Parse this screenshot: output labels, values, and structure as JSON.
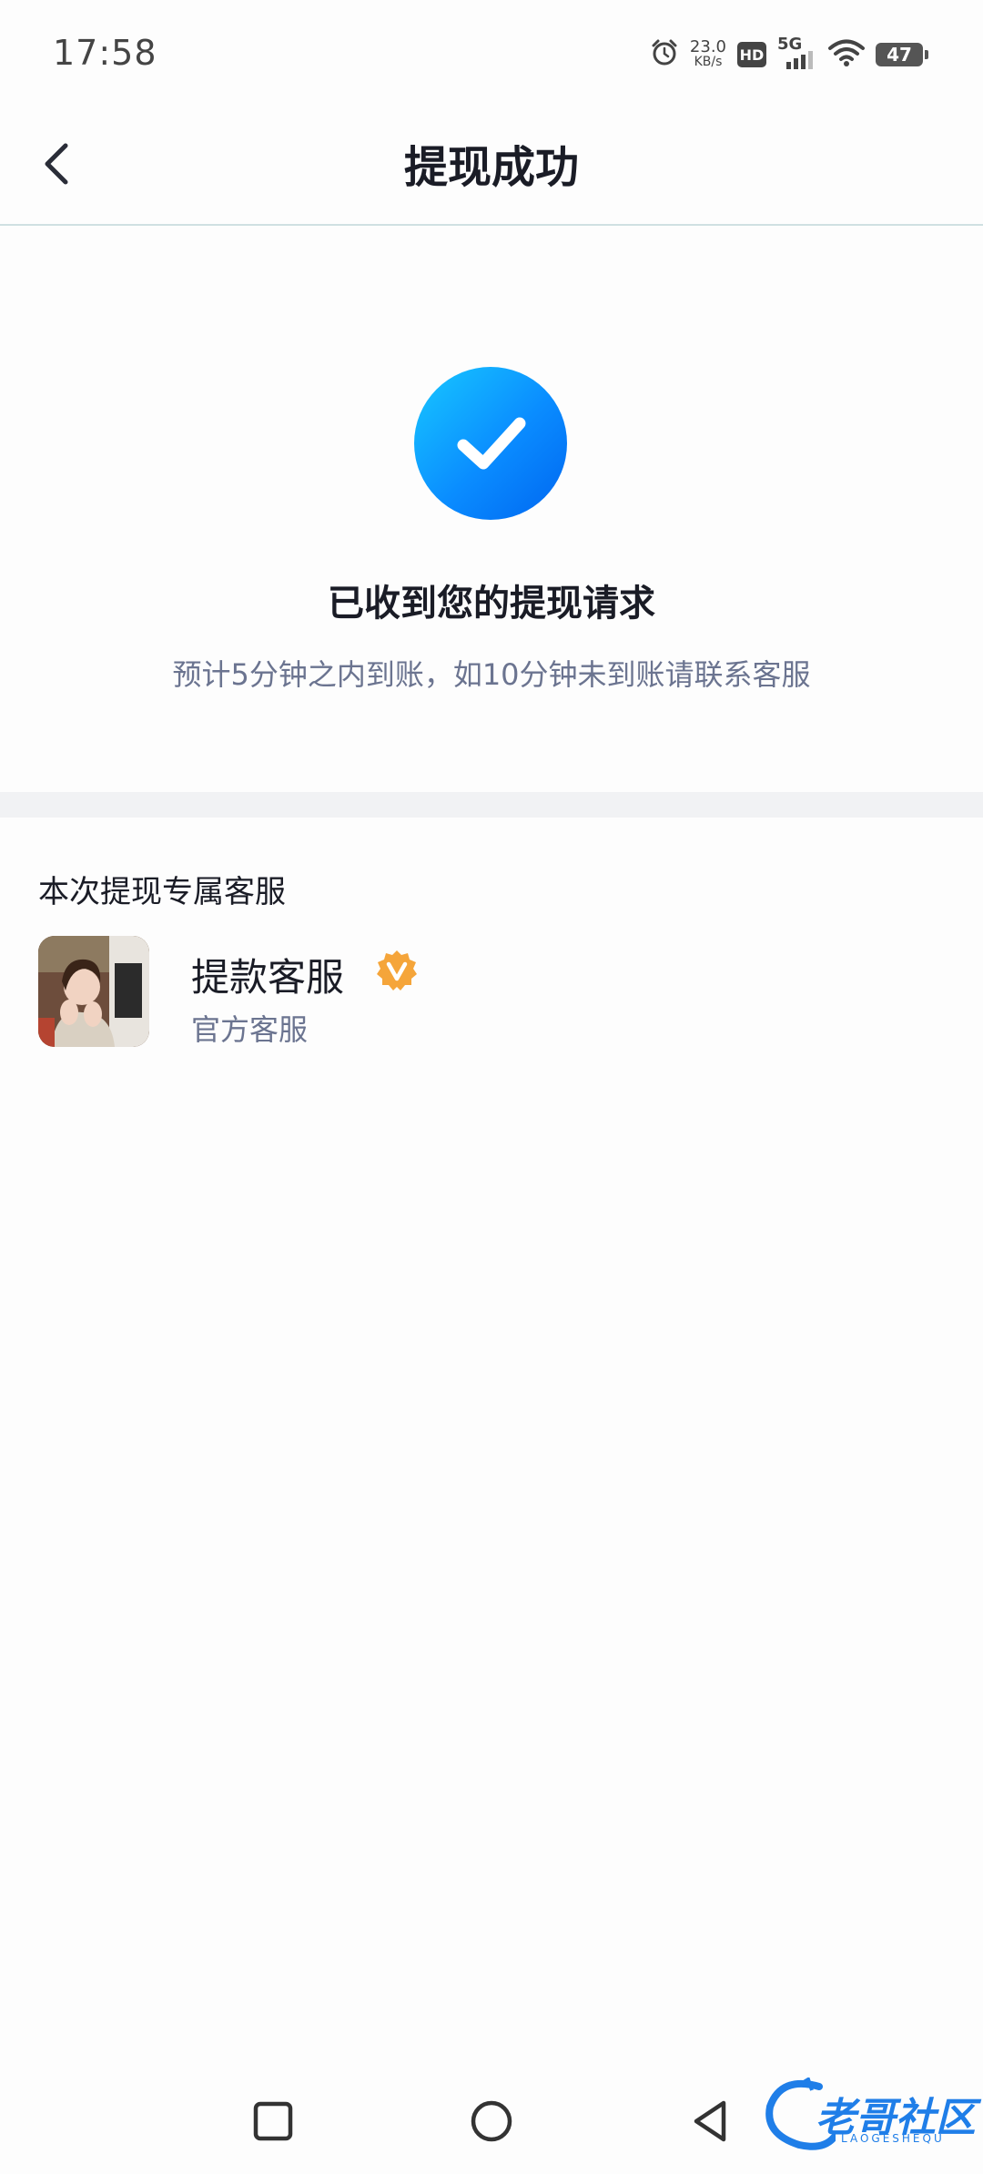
{
  "status_bar": {
    "time": "17:58",
    "net_speed_value": "23.0",
    "net_speed_unit": "KB/s",
    "hd_label": "HD",
    "network_label": "5G",
    "battery_level": "47",
    "icons": [
      "alarm-icon",
      "hd-icon",
      "signal-5g-icon",
      "wifi-icon",
      "battery-icon"
    ]
  },
  "header": {
    "title": "提现成功",
    "back_icon": "chevron-left-icon"
  },
  "success": {
    "icon": "check-circle-icon",
    "accent_color": "#0a8cff",
    "title": "已收到您的提现请求",
    "subtitle": "预计5分钟之内到账，如10分钟未到账请联系客服"
  },
  "service_section": {
    "title": "本次提现专属客服",
    "service": {
      "name": "提款客服",
      "description": "官方客服",
      "badge_icon": "verified-v-icon",
      "badge_color": "#f5a53a"
    }
  },
  "nav_bar": {
    "icons": [
      "recents-square-icon",
      "home-circle-icon",
      "back-triangle-icon"
    ]
  },
  "watermark": {
    "text": "老哥社区",
    "sub": "LAOGESHEQU"
  }
}
